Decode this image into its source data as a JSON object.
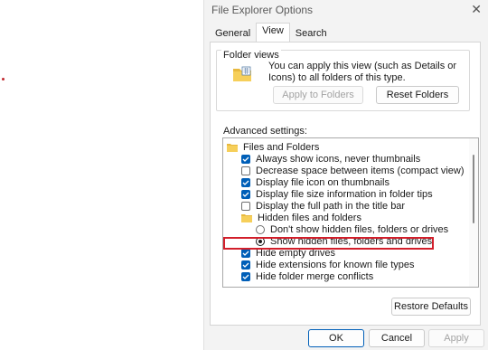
{
  "window": {
    "title": "File Explorer Options",
    "close_glyph": "✕"
  },
  "tabs": [
    {
      "label": "General",
      "active": false
    },
    {
      "label": "View",
      "active": true
    },
    {
      "label": "Search",
      "active": false
    }
  ],
  "folder_views": {
    "label": "Folder views",
    "description": "You can apply this view (such as Details or Icons) to all folders of this type.",
    "apply_button": "Apply to Folders",
    "reset_button": "Reset Folders",
    "icon": "folder-icon"
  },
  "advanced": {
    "label": "Advanced settings:",
    "items": [
      {
        "kind": "folder",
        "label": "Files and Folders"
      },
      {
        "kind": "checkbox",
        "label": "Always show icons, never thumbnails",
        "checked": true
      },
      {
        "kind": "checkbox",
        "label": "Decrease space between items (compact view)",
        "checked": false
      },
      {
        "kind": "checkbox",
        "label": "Display file icon on thumbnails",
        "checked": true
      },
      {
        "kind": "checkbox",
        "label": "Display file size information in folder tips",
        "checked": true
      },
      {
        "kind": "checkbox",
        "label": "Display the full path in the title bar",
        "checked": false
      },
      {
        "kind": "folder",
        "label": "Hidden files and folders"
      },
      {
        "kind": "radio",
        "label": "Don't show hidden files, folders or drives",
        "checked": false
      },
      {
        "kind": "radio",
        "label": "Show hidden files, folders and drives",
        "checked": true
      },
      {
        "kind": "checkbox",
        "label": "Hide empty drives",
        "checked": true
      },
      {
        "kind": "checkbox",
        "label": "Hide extensions for known file types",
        "checked": true
      },
      {
        "kind": "checkbox",
        "label": "Hide folder merge conflicts",
        "checked": true
      }
    ]
  },
  "restore_button": "Restore Defaults",
  "footer": {
    "ok": "OK",
    "cancel": "Cancel",
    "apply": "Apply"
  },
  "colors": {
    "accent": "#005fb8",
    "highlight": "#d21f2b"
  }
}
